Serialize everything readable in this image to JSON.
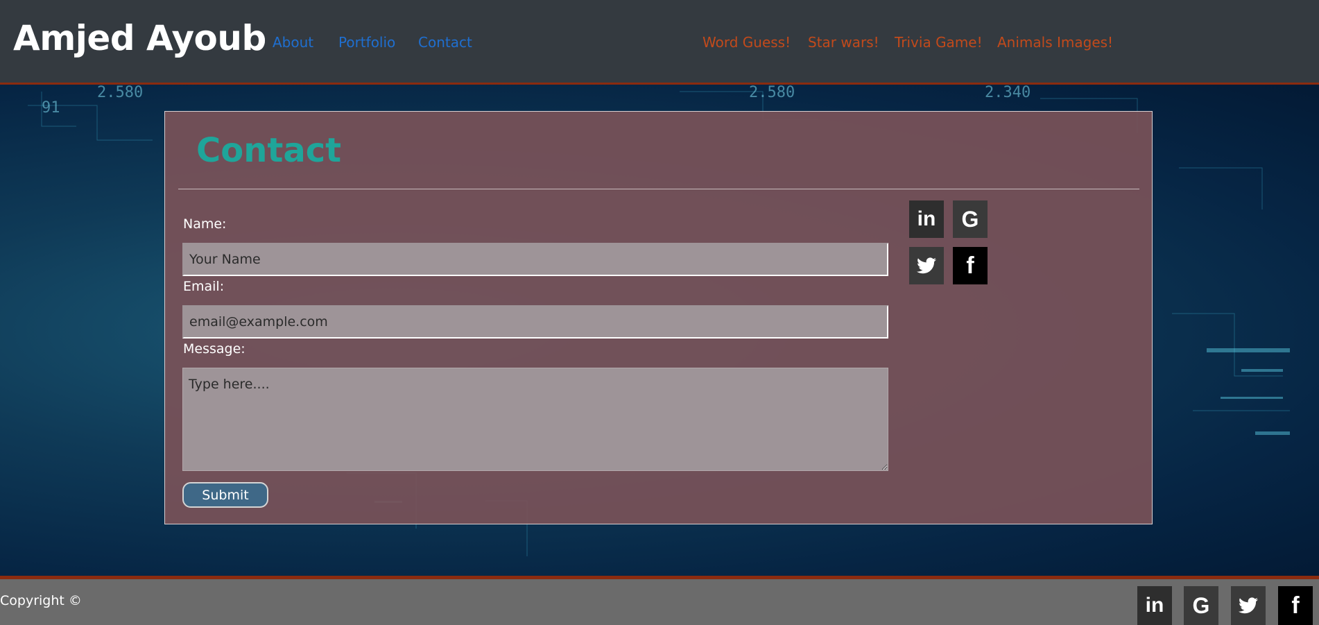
{
  "navbar": {
    "brand": "Amjed Ayoub",
    "links": [
      {
        "label": "About"
      },
      {
        "label": "Portfolio"
      },
      {
        "label": "Contact"
      }
    ],
    "games": [
      {
        "label": "Word Guess!"
      },
      {
        "label": "Star wars!"
      },
      {
        "label": "Trivia Game!"
      },
      {
        "label": "Animals Images!"
      }
    ]
  },
  "contact": {
    "title": "Contact",
    "name_label": "Name:",
    "name_placeholder": "Your Name",
    "email_label": "Email:",
    "email_placeholder": "email@example.com",
    "message_label": "Message:",
    "message_placeholder": "Type here....",
    "submit_label": "Submit"
  },
  "social": {
    "linkedin": "in",
    "google": "G",
    "facebook": "f"
  },
  "footer": {
    "copyright": "Copyright ©"
  },
  "colors": {
    "navbar_bg": "#343a40",
    "accent_line": "#8b2b0f",
    "nav_link": "#1f6fd0",
    "game_link": "#c24a1b",
    "title_teal": "#1fa59a",
    "footer_bg": "#6b6b6b"
  }
}
